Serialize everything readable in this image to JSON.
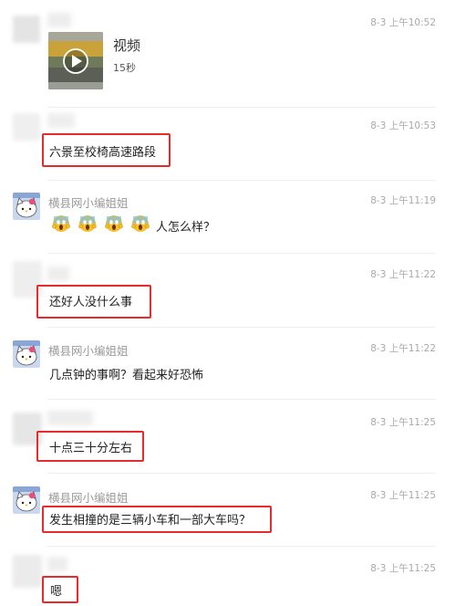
{
  "colors": {
    "highlight": "#e52b2b",
    "time": "#a9a9a9",
    "name": "#9a9a9a"
  },
  "messages": [
    {
      "time": "8-3 上午10:52",
      "video_label": "视频",
      "video_duration": "15秒",
      "avatar_icon": "blurred-avatar"
    },
    {
      "time": "8-3 上午10:53",
      "text": "六景至校椅高速路段",
      "highlighted": true,
      "avatar_icon": "blurred-avatar"
    },
    {
      "name": "横县网小编姐姐",
      "time": "8-3 上午11:19",
      "emojis": [
        "scream-emoji",
        "scream-emoji",
        "scream-emoji",
        "scream-emoji"
      ],
      "text": "人怎么样？",
      "avatar_icon": "hello-kitty-avatar"
    },
    {
      "time": "8-3 上午11:22",
      "text": "还好人没什么事",
      "highlighted": true,
      "avatar_icon": "blurred-avatar"
    },
    {
      "name": "横县网小编姐姐",
      "time": "8-3 上午11:22",
      "text": "几点钟的事啊？看起来好恐怖",
      "avatar_icon": "hello-kitty-avatar"
    },
    {
      "time": "8-3 上午11:25",
      "text": "十点三十分左右",
      "highlighted": true,
      "avatar_icon": "blurred-avatar"
    },
    {
      "name": "横县网小编姐姐",
      "time": "8-3 上午11:25",
      "text": "发生相撞的是三辆小车和一部大车吗？",
      "highlighted": true,
      "avatar_icon": "hello-kitty-avatar"
    },
    {
      "time": "8-3 上午11:25",
      "text": "嗯",
      "highlighted": true,
      "avatar_icon": "blurred-avatar"
    }
  ]
}
